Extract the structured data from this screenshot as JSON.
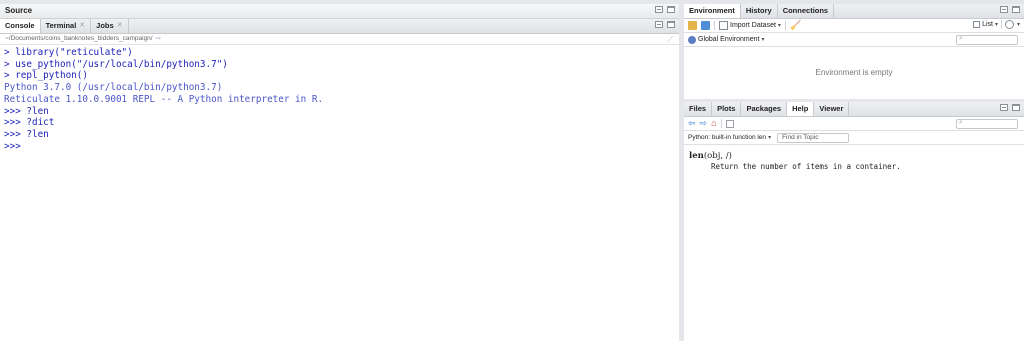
{
  "source_pane": {
    "title": "Source"
  },
  "console_pane": {
    "tabs": [
      {
        "label": "Console",
        "closable": false
      },
      {
        "label": "Terminal",
        "closable": true
      },
      {
        "label": "Jobs",
        "closable": true
      }
    ],
    "path": "~/Documents/coins_banknotes_bidders_campaign/",
    "lines": [
      {
        "type": "cmd",
        "text": "> library(\"reticulate\")"
      },
      {
        "type": "cmd",
        "text": "> use_python(\"/usr/local/bin/python3.7\")"
      },
      {
        "type": "cmd",
        "text": "> repl_python()"
      },
      {
        "type": "out",
        "text": "Python 3.7.0 (/usr/local/bin/python3.7)"
      },
      {
        "type": "out",
        "text": "Reticulate 1.10.0.9001 REPL -- A Python interpreter in R."
      },
      {
        "type": "cmd",
        "text": ">>> ?len"
      },
      {
        "type": "cmd",
        "text": ">>> ?dict"
      },
      {
        "type": "cmd",
        "text": ">>> ?len"
      },
      {
        "type": "cmd",
        "text": ">>>"
      }
    ]
  },
  "env_pane": {
    "tabs": [
      "Environment",
      "History",
      "Connections"
    ],
    "import_dataset": "Import Dataset",
    "list_view": "List",
    "scope": "Global Environment",
    "empty_message": "Environment is empty"
  },
  "help_pane": {
    "tabs": [
      "Files",
      "Plots",
      "Packages",
      "Help",
      "Viewer"
    ],
    "topic": "Python: built-in function len",
    "find_placeholder": "Find in Topic",
    "signature_name": "len",
    "signature_args": "(obj, /)",
    "description": "Return the number of items in a container."
  },
  "colors": {
    "command": "#1b1fb8",
    "output": "#4a55c8",
    "pane_border": "#c6cbd0"
  }
}
